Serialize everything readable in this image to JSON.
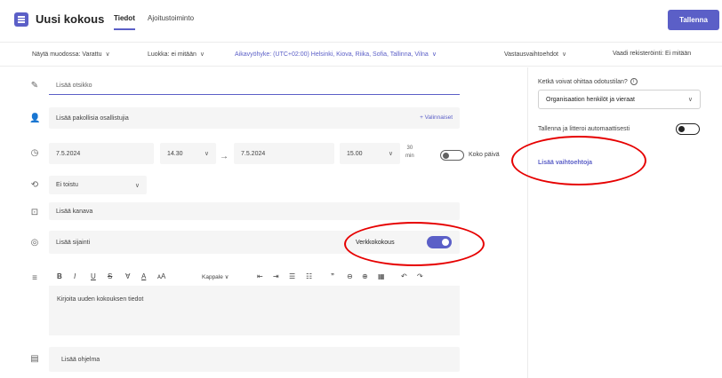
{
  "header": {
    "title": "Uusi kokous",
    "tabs": [
      {
        "label": "Tiedot"
      },
      {
        "label": "Ajoitustoiminto"
      }
    ],
    "save_label": "Tallenna"
  },
  "options_bar": {
    "show_as": "Näytä muodossa: Varattu",
    "category": "Luokka: ei mitään",
    "timezone": "Aikavyöhyke: (UTC+02:00) Helsinki, Kiova, Riika, Sofia, Tallinna, Vilna",
    "response_options": "Vastausvaihtoehdot",
    "registration": "Vaadi rekisteröinti: Ei mitään"
  },
  "form": {
    "title_placeholder": "Lisää otsikko",
    "attendees_placeholder": "Lisää pakollisia osallistujia",
    "optional_link": "+ Valinnaiset",
    "start_date": "7.5.2024",
    "start_time": "14.30",
    "end_date": "7.5.2024",
    "end_time": "15.00",
    "duration_value": "30",
    "duration_unit": "min",
    "all_day_label": "Koko päivä",
    "repeat": "Ei toistu",
    "channel_placeholder": "Lisää kanava",
    "location_placeholder": "Lisää sijainti",
    "online_meeting_label": "Verkkokokous",
    "paragraph_style": "Kappale",
    "details_placeholder": "Kirjoita uuden kokouksen tiedot",
    "agenda_placeholder": "Lisää ohjelma"
  },
  "right_panel": {
    "lobby_label": "Ketkä voivat ohittaa odotustilan?",
    "lobby_value": "Organisaation henkilöt ja vieraat",
    "record_label": "Tallenna ja litteroi automaattisesti",
    "more_options_link": "Lisää vaihtoehtoja"
  },
  "colors": {
    "accent": "#5b5fc7",
    "annotation": "#e60000"
  }
}
